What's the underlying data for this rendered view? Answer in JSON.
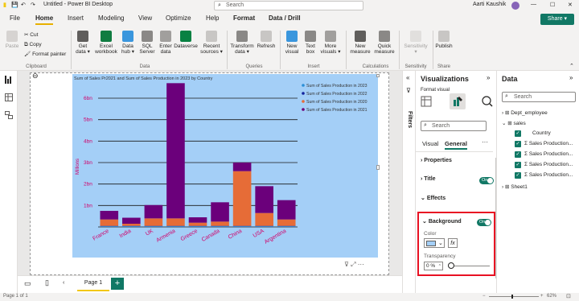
{
  "titlebar": {
    "title": "Untitled - Power BI Desktop",
    "search": "Search",
    "user": "Aarti Kaushik"
  },
  "tabs": [
    "File",
    "Home",
    "Insert",
    "Modeling",
    "View",
    "Optimize",
    "Help",
    "Format",
    "Data / Drill"
  ],
  "share_label": "Share",
  "ribbon": {
    "clipboard": {
      "paste": "Paste",
      "cut": "Cut",
      "copy": "Copy",
      "format_painter": "Format painter",
      "group": "Clipboard"
    },
    "data": {
      "get_data": "Get data",
      "excel": "Excel workbook",
      "data_hub": "Data hub",
      "sql": "SQL Server",
      "enter": "Enter data",
      "dataverse": "Dataverse",
      "recent": "Recent sources",
      "group": "Data"
    },
    "queries": {
      "transform": "Transform data",
      "refresh": "Refresh",
      "group": "Queries"
    },
    "insert": {
      "new_visual": "New visual",
      "text_box": "Text box",
      "more": "More visuals",
      "group": "Insert"
    },
    "calc": {
      "new_measure": "New measure",
      "quick_measure": "Quick measure",
      "group": "Calculations"
    },
    "sensitivity": {
      "label": "Sensitivity",
      "group": "Sensitivity"
    },
    "share": {
      "publish": "Publish",
      "group": "Share"
    }
  },
  "canvas": {
    "page_tab": "Page 1",
    "add_page": "+"
  },
  "status": {
    "page": "Page 1 of 1",
    "zoom": "62%"
  },
  "filters_label": "Filters",
  "viz_pane": {
    "title": "Visualizations",
    "format_visual": "Format visual",
    "search": "Search",
    "tab_visual": "Visual",
    "tab_general": "General",
    "more": "···",
    "sections": {
      "properties": "Properties",
      "title": "Title",
      "effects": "Effects",
      "background": "Background"
    },
    "toggle_on": "On",
    "color_label": "Color",
    "fx": "fx",
    "transparency_label": "Transparency",
    "transparency_value": "0 %"
  },
  "data_pane": {
    "title": "Data",
    "search": "Search",
    "tables": [
      "Dept_employee",
      "sales",
      "Sheet1"
    ],
    "fields": [
      "Country",
      "Sales Production...",
      "Sales Production...",
      "Sales Production...",
      "Sales Production..."
    ]
  },
  "colors": {
    "accent": "#117865",
    "chart_bg": "#a4cff7",
    "highlight": "#e81123"
  },
  "chart_data": {
    "type": "bar",
    "title": "Sum of Sales Pr2021 and Sum of Sales Production in 2023 by Country",
    "ylabel": "Millions",
    "ytick_labels": [
      "1bn",
      "2bn",
      "3bn",
      "4bn",
      "5bn",
      "6bn"
    ],
    "ylim": [
      0,
      6.6
    ],
    "categories": [
      "France",
      "India",
      "UK",
      "Armenia",
      "Greece",
      "Canada",
      "China",
      "USA",
      "Argentina"
    ],
    "series": [
      {
        "name": "Sum of Sales Production in 2023",
        "color": "#2b8fd6",
        "values": [
          0.03,
          0.03,
          0.03,
          0.03,
          0.03,
          0.03,
          0.03,
          0.03,
          0.03
        ]
      },
      {
        "name": "Sum of Sales Production in 2022",
        "color": "#12239e",
        "values": [
          0.02,
          0.02,
          0.02,
          0.02,
          0.02,
          0.02,
          0.02,
          0.02,
          0.02
        ]
      },
      {
        "name": "Sum of Sales Production in 2020",
        "color": "#e66c37",
        "values": [
          0.3,
          0.1,
          0.35,
          0.35,
          0.15,
          0.2,
          2.55,
          0.6,
          0.3
        ]
      },
      {
        "name": "Sum of Sales Production in 2021",
        "color": "#6b007b",
        "values": [
          0.4,
          0.28,
          0.62,
          6.3,
          0.25,
          0.9,
          0.4,
          1.25,
          0.9
        ]
      }
    ]
  }
}
